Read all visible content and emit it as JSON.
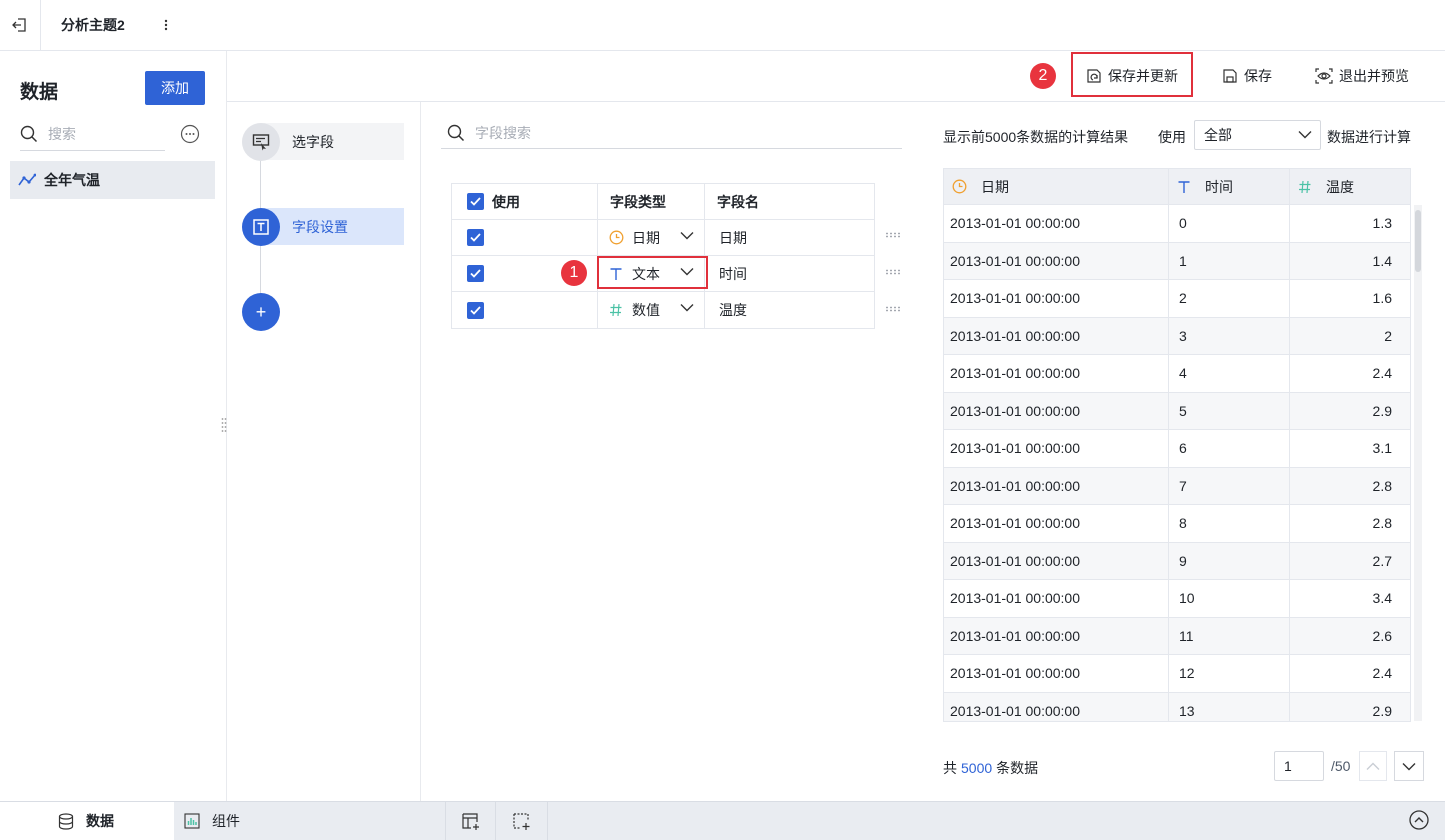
{
  "top": {
    "theme_name": "分析主题2"
  },
  "left": {
    "title": "数据",
    "add_label": "添加",
    "search_placeholder": "搜索",
    "dataset": "全年气温"
  },
  "steps": {
    "select_fields": "选字段",
    "field_settings": "字段设置",
    "add": "+"
  },
  "toolbar": {
    "save_update": "保存并更新",
    "save": "保存",
    "exit_preview": "退出并预览",
    "badge": "2"
  },
  "fields": {
    "search_placeholder": "字段搜索",
    "headers": {
      "use": "使用",
      "type": "字段类型",
      "name": "字段名"
    },
    "rows": [
      {
        "type_icon": "clock-icon",
        "type": "日期",
        "name": "日期"
      },
      {
        "type_icon": "text-type-icon",
        "type": "文本",
        "name": "时间"
      },
      {
        "type_icon": "hash-icon",
        "type": "数值",
        "name": "温度"
      }
    ],
    "badge": "1"
  },
  "preview": {
    "desc": "显示前5000条数据的计算结果",
    "use_label": "使用",
    "scope": "全部",
    "calc_label": "数据进行计算",
    "columns": [
      "日期",
      "时间",
      "温度"
    ],
    "rows": [
      [
        "2013-01-01 00:00:00",
        "0",
        "1.3"
      ],
      [
        "2013-01-01 00:00:00",
        "1",
        "1.4"
      ],
      [
        "2013-01-01 00:00:00",
        "2",
        "1.6"
      ],
      [
        "2013-01-01 00:00:00",
        "3",
        "2"
      ],
      [
        "2013-01-01 00:00:00",
        "4",
        "2.4"
      ],
      [
        "2013-01-01 00:00:00",
        "5",
        "2.9"
      ],
      [
        "2013-01-01 00:00:00",
        "6",
        "3.1"
      ],
      [
        "2013-01-01 00:00:00",
        "7",
        "2.8"
      ],
      [
        "2013-01-01 00:00:00",
        "8",
        "2.8"
      ],
      [
        "2013-01-01 00:00:00",
        "9",
        "2.7"
      ],
      [
        "2013-01-01 00:00:00",
        "10",
        "3.4"
      ],
      [
        "2013-01-01 00:00:00",
        "11",
        "2.6"
      ],
      [
        "2013-01-01 00:00:00",
        "12",
        "2.4"
      ],
      [
        "2013-01-01 00:00:00",
        "13",
        "2.9"
      ]
    ],
    "total_prefix": "共",
    "total_count": "5000",
    "total_suffix": "条数据",
    "page": "1",
    "page_total": "/50"
  },
  "bottom": {
    "data_tab": "数据",
    "widget_tab": "组件"
  },
  "colors": {
    "accent": "#2f63d6",
    "highlight": "#e0303b",
    "date_icon": "#f0a030",
    "text_icon": "#2f63d6",
    "num_icon": "#4cc2a6"
  }
}
